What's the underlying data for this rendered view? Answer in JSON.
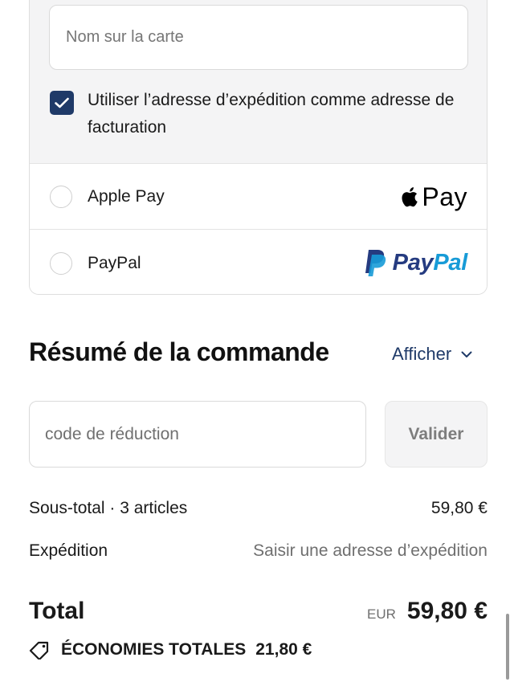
{
  "payment": {
    "name_placeholder": "Nom sur la carte",
    "billing_checkbox_label": "Utiliser l’adresse d’expédition comme adresse de facturation",
    "billing_checkbox_checked": true,
    "methods": [
      {
        "label": "Apple Pay",
        "logo_text": "Pay",
        "selected": false
      },
      {
        "label": "PayPal",
        "logo_text_dark": "Pay",
        "logo_text_light": "Pal",
        "selected": false
      }
    ]
  },
  "summary": {
    "title": "Résumé de la commande",
    "toggle_label": "Afficher",
    "discount_placeholder": "code de réduction",
    "apply_label": "Valider",
    "subtotal_label": "Sous-total · 3 articles",
    "subtotal_value": "59,80 €",
    "shipping_label": "Expédition",
    "shipping_value": "Saisir une adresse d’expédition",
    "total_label": "Total",
    "total_currency": "EUR",
    "total_value": "59,80 €",
    "savings_label": "ÉCONOMIES TOTALES",
    "savings_value": "21,80 €"
  },
  "colors": {
    "accent": "#1f3a68",
    "paypal_dark": "#253b80",
    "paypal_light": "#179bd7",
    "muted_text": "#6f6f6f"
  }
}
